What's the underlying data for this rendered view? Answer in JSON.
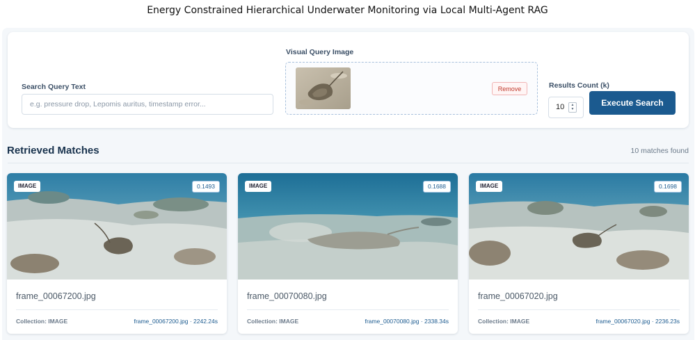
{
  "page": {
    "title": "Energy Constrained Hierarchical Underwater Monitoring via Local Multi-Agent RAG"
  },
  "search": {
    "text_label": "Search Query Text",
    "text_placeholder": "e.g. pressure drop, Lepomis auritus, timestamp error...",
    "text_value": "",
    "image_label": "Visual Query Image",
    "remove_label": "Remove",
    "k_label": "Results Count (k)",
    "k_value": "10",
    "execute_label": "Execute Search"
  },
  "results": {
    "title": "Retrieved Matches",
    "count_text": "10 matches found",
    "items": [
      {
        "type": "IMAGE",
        "score": "0.1493",
        "filename": "frame_00067200.jpg",
        "collection": "Collection: IMAGE",
        "meta": "frame_00067200.jpg · 2242.24s"
      },
      {
        "type": "IMAGE",
        "score": "0.1688",
        "filename": "frame_00070080.jpg",
        "collection": "Collection: IMAGE",
        "meta": "frame_00070080.jpg · 2338.34s"
      },
      {
        "type": "IMAGE",
        "score": "0.1698",
        "filename": "frame_00067020.jpg",
        "collection": "Collection: IMAGE",
        "meta": "frame_00067020.jpg · 2236.23s"
      }
    ]
  },
  "colors": {
    "accent": "#1b5a8f",
    "remove": "#c0392b",
    "background": "#f4f7fa"
  }
}
